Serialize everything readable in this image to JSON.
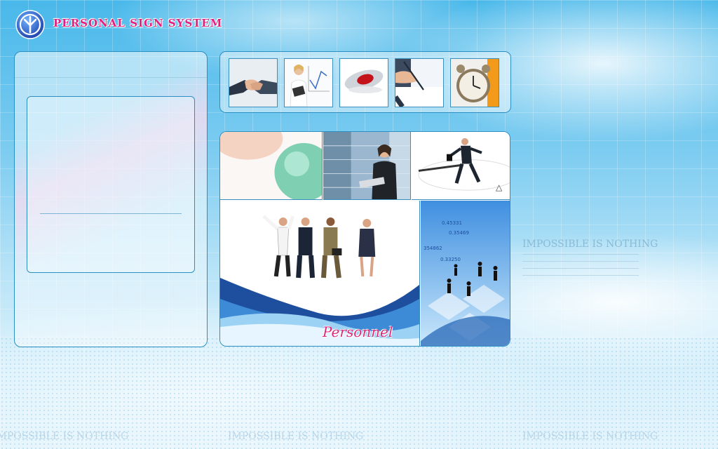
{
  "header": {
    "title": "PERSONAL SIGN SYSTEM",
    "logo_icon": "round-emblem-icon"
  },
  "colors": {
    "brand_pink": "#e2207f",
    "panel_border": "#2b8fc2",
    "sky_blue": "#48b8ea"
  },
  "thumbnails": [
    {
      "name": "handshake",
      "icon": "handshake-icon"
    },
    {
      "name": "presenter",
      "icon": "presenter-chart-icon"
    },
    {
      "name": "mouse",
      "icon": "computer-mouse-icon"
    },
    {
      "name": "signing",
      "icon": "pen-signing-icon"
    },
    {
      "name": "clock",
      "icon": "alarm-clock-icon"
    }
  ],
  "collage": {
    "banner_text": "Personnel"
  },
  "background": {
    "slogan": "IMPOSSIBLE IS NOTHING"
  }
}
